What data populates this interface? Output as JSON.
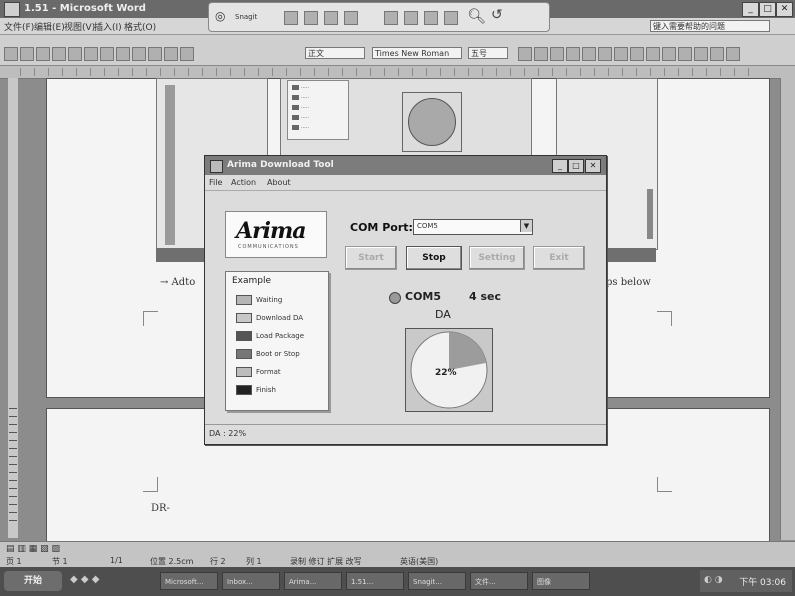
{
  "word": {
    "title": "1.51 - Microsoft Word",
    "menu": [
      "文件(F)",
      "编辑(E)",
      "视图(V)",
      "插入(I)",
      "格式(O)"
    ],
    "style_combo": "正文",
    "font_combo": "Times New Roman",
    "size_combo": "五号",
    "help_box": "键入需要帮助的问题",
    "toolbar_title": "Snagit"
  },
  "page": {
    "arrow_text_left": "→ Adto",
    "arrow_text_right": "ps below",
    "page2_text": "DR-"
  },
  "dialog": {
    "title": "Arima Download Tool",
    "menu": [
      "File",
      "Action",
      "About"
    ],
    "logo_text": "Arima",
    "logo_sub": "COMMUNICATIONS",
    "legend_title": "Example",
    "legend_items": [
      {
        "label": "Waiting",
        "color": "#b5b5b5"
      },
      {
        "label": "Download DA",
        "color": "#c8c8c8"
      },
      {
        "label": "Load Package",
        "color": "#555555"
      },
      {
        "label": "Boot or Stop",
        "color": "#777777"
      },
      {
        "label": "Format",
        "color": "#bdbdbd"
      },
      {
        "label": "Finish",
        "color": "#222222"
      }
    ],
    "com_label": "COM Port:",
    "com_value": "COM5",
    "buttons": [
      {
        "label": "Start",
        "enabled": false
      },
      {
        "label": "Stop",
        "enabled": true
      },
      {
        "label": "Setting",
        "enabled": false
      },
      {
        "label": "Exit",
        "enabled": false
      }
    ],
    "com_status": "COM5",
    "timer": "4 sec",
    "pie_title": "DA",
    "pie_percent_label": "22%",
    "pie_percent": 0.22,
    "pie_done_color": "#9c9c9c",
    "pie_rest_color": "#f1f1f1",
    "status_text": "DA : 22%"
  },
  "statusbar": {
    "page": "页 1",
    "section": "节 1",
    "pages": "1/1",
    "position": "位置 2.5cm",
    "line": "行 2",
    "column": "列 1",
    "modes": "录制 修订 扩展 改写",
    "language": "英语(美国)"
  },
  "taskbar": {
    "start": "开始",
    "tasks": [
      "Microsoft...",
      "Inbox...",
      "Arima...",
      "1.51...",
      "Snagit...",
      "文件...",
      "图像"
    ],
    "clock": "下午 03:06"
  }
}
